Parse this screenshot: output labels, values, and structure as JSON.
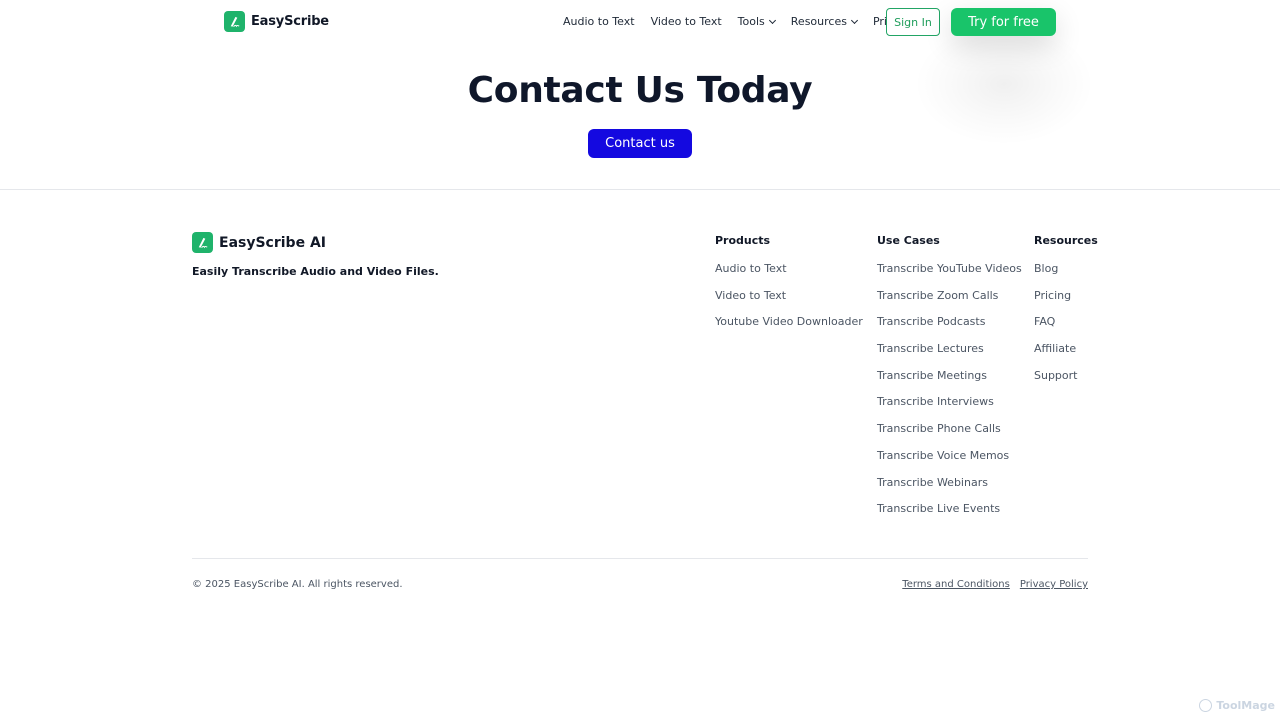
{
  "header": {
    "brand": "EasyScribe",
    "nav": [
      {
        "label": "Audio to Text",
        "has_dropdown": false
      },
      {
        "label": "Video to Text",
        "has_dropdown": false
      },
      {
        "label": "Tools",
        "has_dropdown": true
      },
      {
        "label": "Resources",
        "has_dropdown": true
      },
      {
        "label": "Pricing",
        "has_dropdown": false
      }
    ],
    "sign_in": "Sign In",
    "try_free": "Try for free"
  },
  "hero": {
    "title": "Contact Us Today",
    "button": "Contact us"
  },
  "footer": {
    "brand": "EasyScribe AI",
    "tagline": "Easily Transcribe Audio and Video Files.",
    "columns": {
      "products": {
        "heading": "Products",
        "links": [
          "Audio to Text",
          "Video to Text",
          "Youtube Video Downloader"
        ]
      },
      "use_cases": {
        "heading": "Use Cases",
        "links": [
          "Transcribe YouTube Videos",
          "Transcribe Zoom Calls",
          "Transcribe Podcasts",
          "Transcribe Lectures",
          "Transcribe Meetings",
          "Transcribe Interviews",
          "Transcribe Phone Calls",
          "Transcribe Voice Memos",
          "Transcribe Webinars",
          "Transcribe Live Events"
        ]
      },
      "resources": {
        "heading": "Resources",
        "links": [
          "Blog",
          "Pricing",
          "FAQ",
          "Affiliate",
          "Support"
        ]
      }
    },
    "copyright": "© 2025 EasyScribe AI. All rights reserved.",
    "terms": "Terms and Conditions",
    "privacy": "Privacy Policy"
  },
  "watermark": "ToolMage",
  "colors": {
    "brand_green": "#19c46a",
    "contact_blue": "#1409e0",
    "signin_border": "#22a565"
  },
  "icons": {
    "logo": "pen-nib-logo-icon",
    "dropdown": "chevron-down-icon",
    "watermark": "toolmage-logo-icon"
  }
}
